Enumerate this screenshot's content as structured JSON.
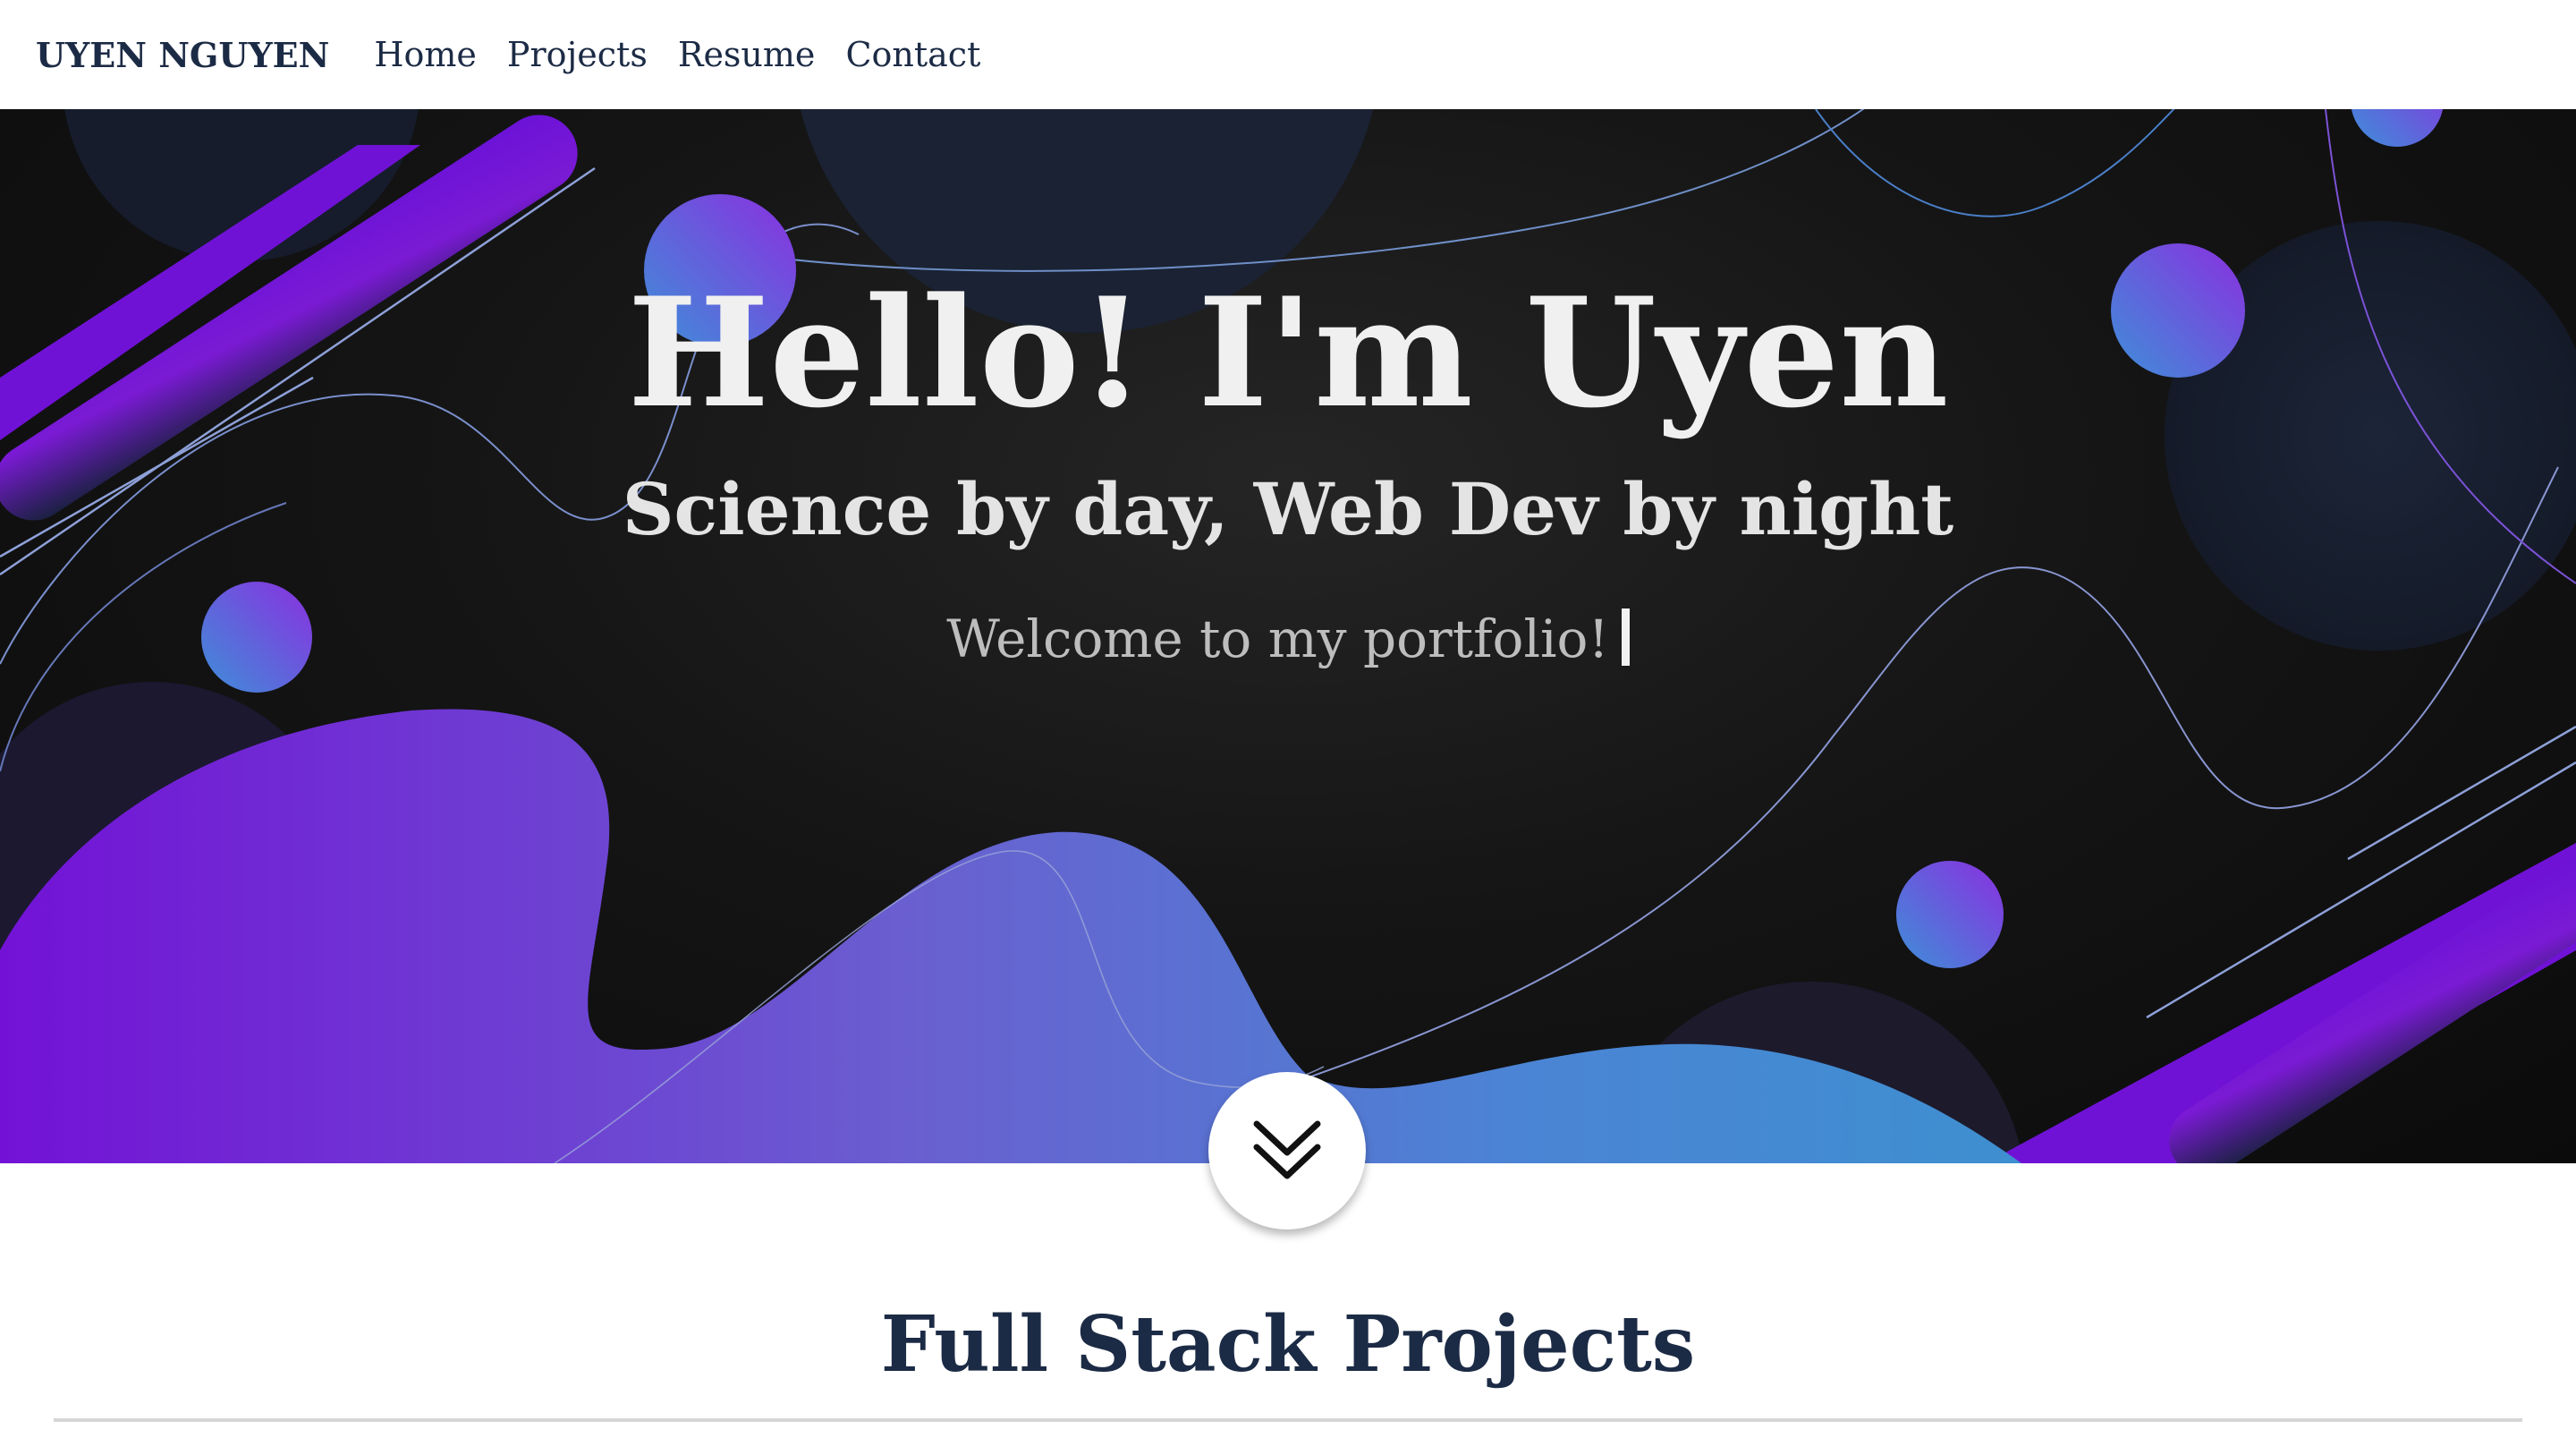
{
  "navbar": {
    "brand": "UYEN NGUYEN",
    "links": [
      "Home",
      "Projects",
      "Resume",
      "Contact"
    ]
  },
  "hero": {
    "title": "Hello! I'm Uyen",
    "subtitle": "Science by day, Web Dev by night",
    "welcome": "Welcome to my portfolio!"
  },
  "icons": {
    "scroll_down": "double-chevron-down-icon"
  },
  "projects_section": {
    "title": "Full Stack Projects"
  },
  "colors": {
    "navy": "#1c2b45",
    "purple": "#7014d6",
    "blue": "#3f8fd0",
    "hero_bg": "#121212"
  }
}
